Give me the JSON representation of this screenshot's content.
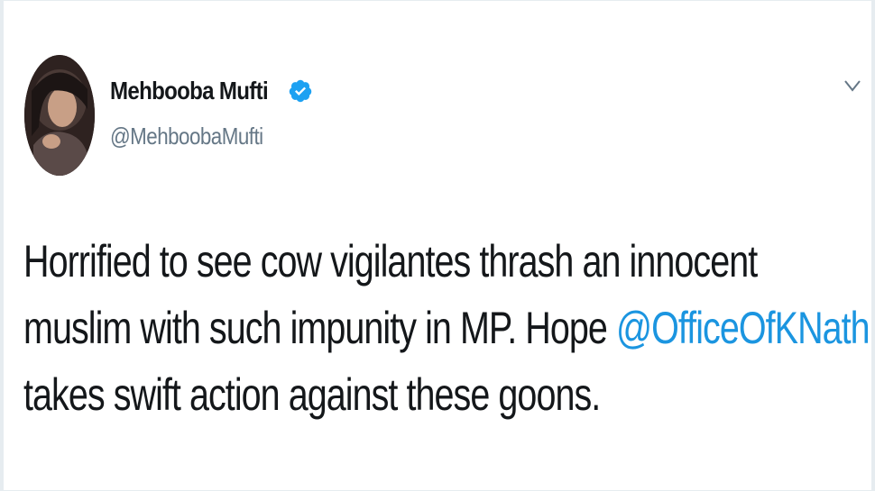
{
  "author": {
    "display_name": "Mehbooba Mufti",
    "handle": "@MehboobaMufti",
    "verified": true
  },
  "tweet": {
    "line1": "Horrified to see cow vigilantes thrash an innocent",
    "line2_prefix": "muslim with such impunity in MP. Hope ",
    "mention": "@OfficeOfKNath",
    "line3": "takes swift action against these goons."
  },
  "colors": {
    "text": "#14171a",
    "muted": "#657786",
    "link": "#1b95e0",
    "verified": "#1da1f2"
  },
  "icons": {
    "verified": "verified-badge-icon",
    "menu": "chevron-down-icon"
  }
}
